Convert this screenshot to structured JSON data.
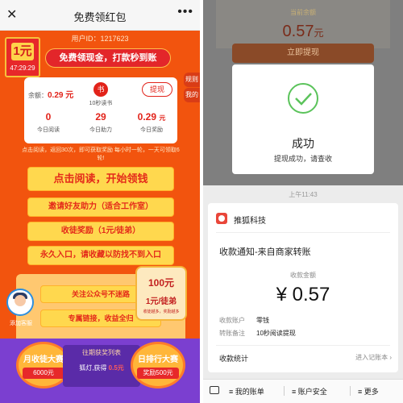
{
  "left": {
    "nav": {
      "close": "✕",
      "title": "免费领红包",
      "more": "•••"
    },
    "user_id": "用户ID：1217623",
    "coupon": {
      "amount": "1元",
      "timer": "47:29:29"
    },
    "promo": "免费领现金，打款秒到账",
    "rules": "规则",
    "mine": "我的",
    "card": {
      "balance_label": "余额：",
      "balance_value": "0.29 元",
      "icon_glyph": "书",
      "caption": "10秒读书",
      "withdraw": "提现",
      "stats": [
        {
          "value": "0",
          "label": "今日阅读"
        },
        {
          "value": "29",
          "label": "今日助力"
        },
        {
          "value": "0.29",
          "label": "今日奖励",
          "unit": "元"
        }
      ]
    },
    "note": "点击阅读，返回30次，即可获取奖励 每小时一轮，一天可领取6轮!",
    "buttons": [
      "点击阅读，开始领钱",
      "邀请好友助力（适合工作室）",
      "收徒奖励（1元/徒弟）",
      "永久入口，请收藏以防找不到入口"
    ],
    "sub_buttons": [
      "关注公众号不迷路",
      "专属链接，收益全归"
    ],
    "support": "添加客服",
    "prize": {
      "amount": "100元",
      "per": "1元/徒弟",
      "fine": "收徒越多，奖励越多"
    },
    "badges": [
      {
        "title": "月收徒大赛",
        "sub": "6000元"
      },
      {
        "title": "日排行大赛",
        "sub": "奖励500元"
      }
    ],
    "list": {
      "header": "往期获奖列表",
      "row_prefix": "狐灯,获得",
      "row_value": "0.5元"
    }
  },
  "right": {
    "balance_label": "当前余额",
    "balance_value": "0.57",
    "balance_unit": "元",
    "withdraw_button": "立即提现",
    "modal": {
      "title": "成功",
      "subtitle": "提现成功，请查收"
    },
    "time": "上午11:43",
    "message": {
      "sender": "推狐科技",
      "title": "收款通知-来自商家转账",
      "amount_label": "收款金额",
      "amount": "¥ 0.57",
      "rows": [
        {
          "label": "收款账户",
          "value": "零钱"
        },
        {
          "label": "转账备注",
          "value": "10秒阅读提现"
        }
      ],
      "summary": "收款统计",
      "ledger": "进入记账本 ›"
    },
    "tabs": [
      "≡ 我的账单",
      "≡ 账户安全",
      "≡ 更多"
    ]
  }
}
